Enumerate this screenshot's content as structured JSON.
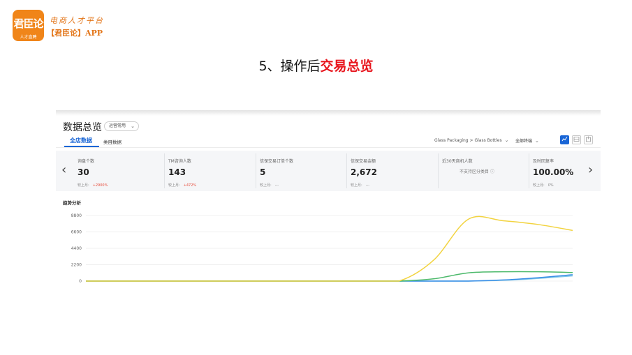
{
  "brand": {
    "logo_text": "君臣论",
    "logo_subtext": "人才直聘",
    "slogan": "电商人才平台",
    "app_name": "【君臣论】APP",
    "accent": "#f08519"
  },
  "slide": {
    "title_prefix": "5、操作后",
    "title_highlight": "交易总览",
    "highlight_color": "#e8161e"
  },
  "dashboard": {
    "title": "数据总览",
    "mode_select": "运营常用",
    "tabs": [
      {
        "label": "全店数据",
        "active": true
      },
      {
        "label": "类目数据",
        "active": false
      }
    ],
    "category_path": "Glass Packaging > Glass Bottles",
    "terminal_select": "全部终端",
    "accent_color": "#1a66d6",
    "view_icons": [
      "line-chart-icon",
      "table-icon",
      "export-icon"
    ],
    "metrics": [
      {
        "label": "询盘个数",
        "value": "30",
        "compare_label": "较上月:",
        "compare_value": "+2900%",
        "trend": "up"
      },
      {
        "label": "TM咨询人数",
        "value": "143",
        "compare_label": "较上月:",
        "compare_value": "+472%",
        "trend": "up"
      },
      {
        "label": "信保交易订单个数",
        "value": "5",
        "compare_label": "较上月:",
        "compare_value": "---",
        "trend": "flat"
      },
      {
        "label": "信保交易金额",
        "value": "2,672",
        "compare_label": "较上月:",
        "compare_value": "---",
        "trend": "flat"
      },
      {
        "label": "近30天商机人数",
        "value": "",
        "note": "不支持区分类目",
        "compare_label": "",
        "compare_value": "",
        "trend": "none"
      },
      {
        "label": "及时回复率",
        "value": "100.00%",
        "compare_label": "较上月:",
        "compare_value": "0%",
        "trend": "flat"
      }
    ],
    "trend_title": "趋势分析"
  },
  "chart_data": {
    "type": "line",
    "ylim": [
      0,
      8800
    ],
    "yticks": [
      0,
      2200,
      4400,
      6600,
      8800
    ],
    "x": [
      0,
      1,
      2,
      3,
      4,
      5,
      6,
      7,
      8,
      9,
      10,
      11,
      12,
      13,
      14
    ],
    "series": [
      {
        "color": "#f2d33f",
        "values": [
          0,
          0,
          0,
          0,
          0,
          0,
          0,
          0,
          0,
          0,
          2800,
          8300,
          8100,
          7600,
          6800
        ]
      },
      {
        "color": "#4cb96b",
        "values": [
          0,
          0,
          0,
          0,
          0,
          0,
          0,
          0,
          0,
          0,
          300,
          1100,
          1250,
          1250,
          1150
        ]
      },
      {
        "color": "#3a8ee6",
        "values": [
          0,
          0,
          0,
          0,
          0,
          0,
          0,
          0,
          0,
          0,
          0,
          0,
          150,
          450,
          850
        ]
      },
      {
        "color": "#7fc7e8",
        "values": [
          0,
          0,
          0,
          0,
          0,
          0,
          0,
          0,
          0,
          0,
          0,
          0,
          100,
          350,
          700
        ]
      }
    ]
  }
}
